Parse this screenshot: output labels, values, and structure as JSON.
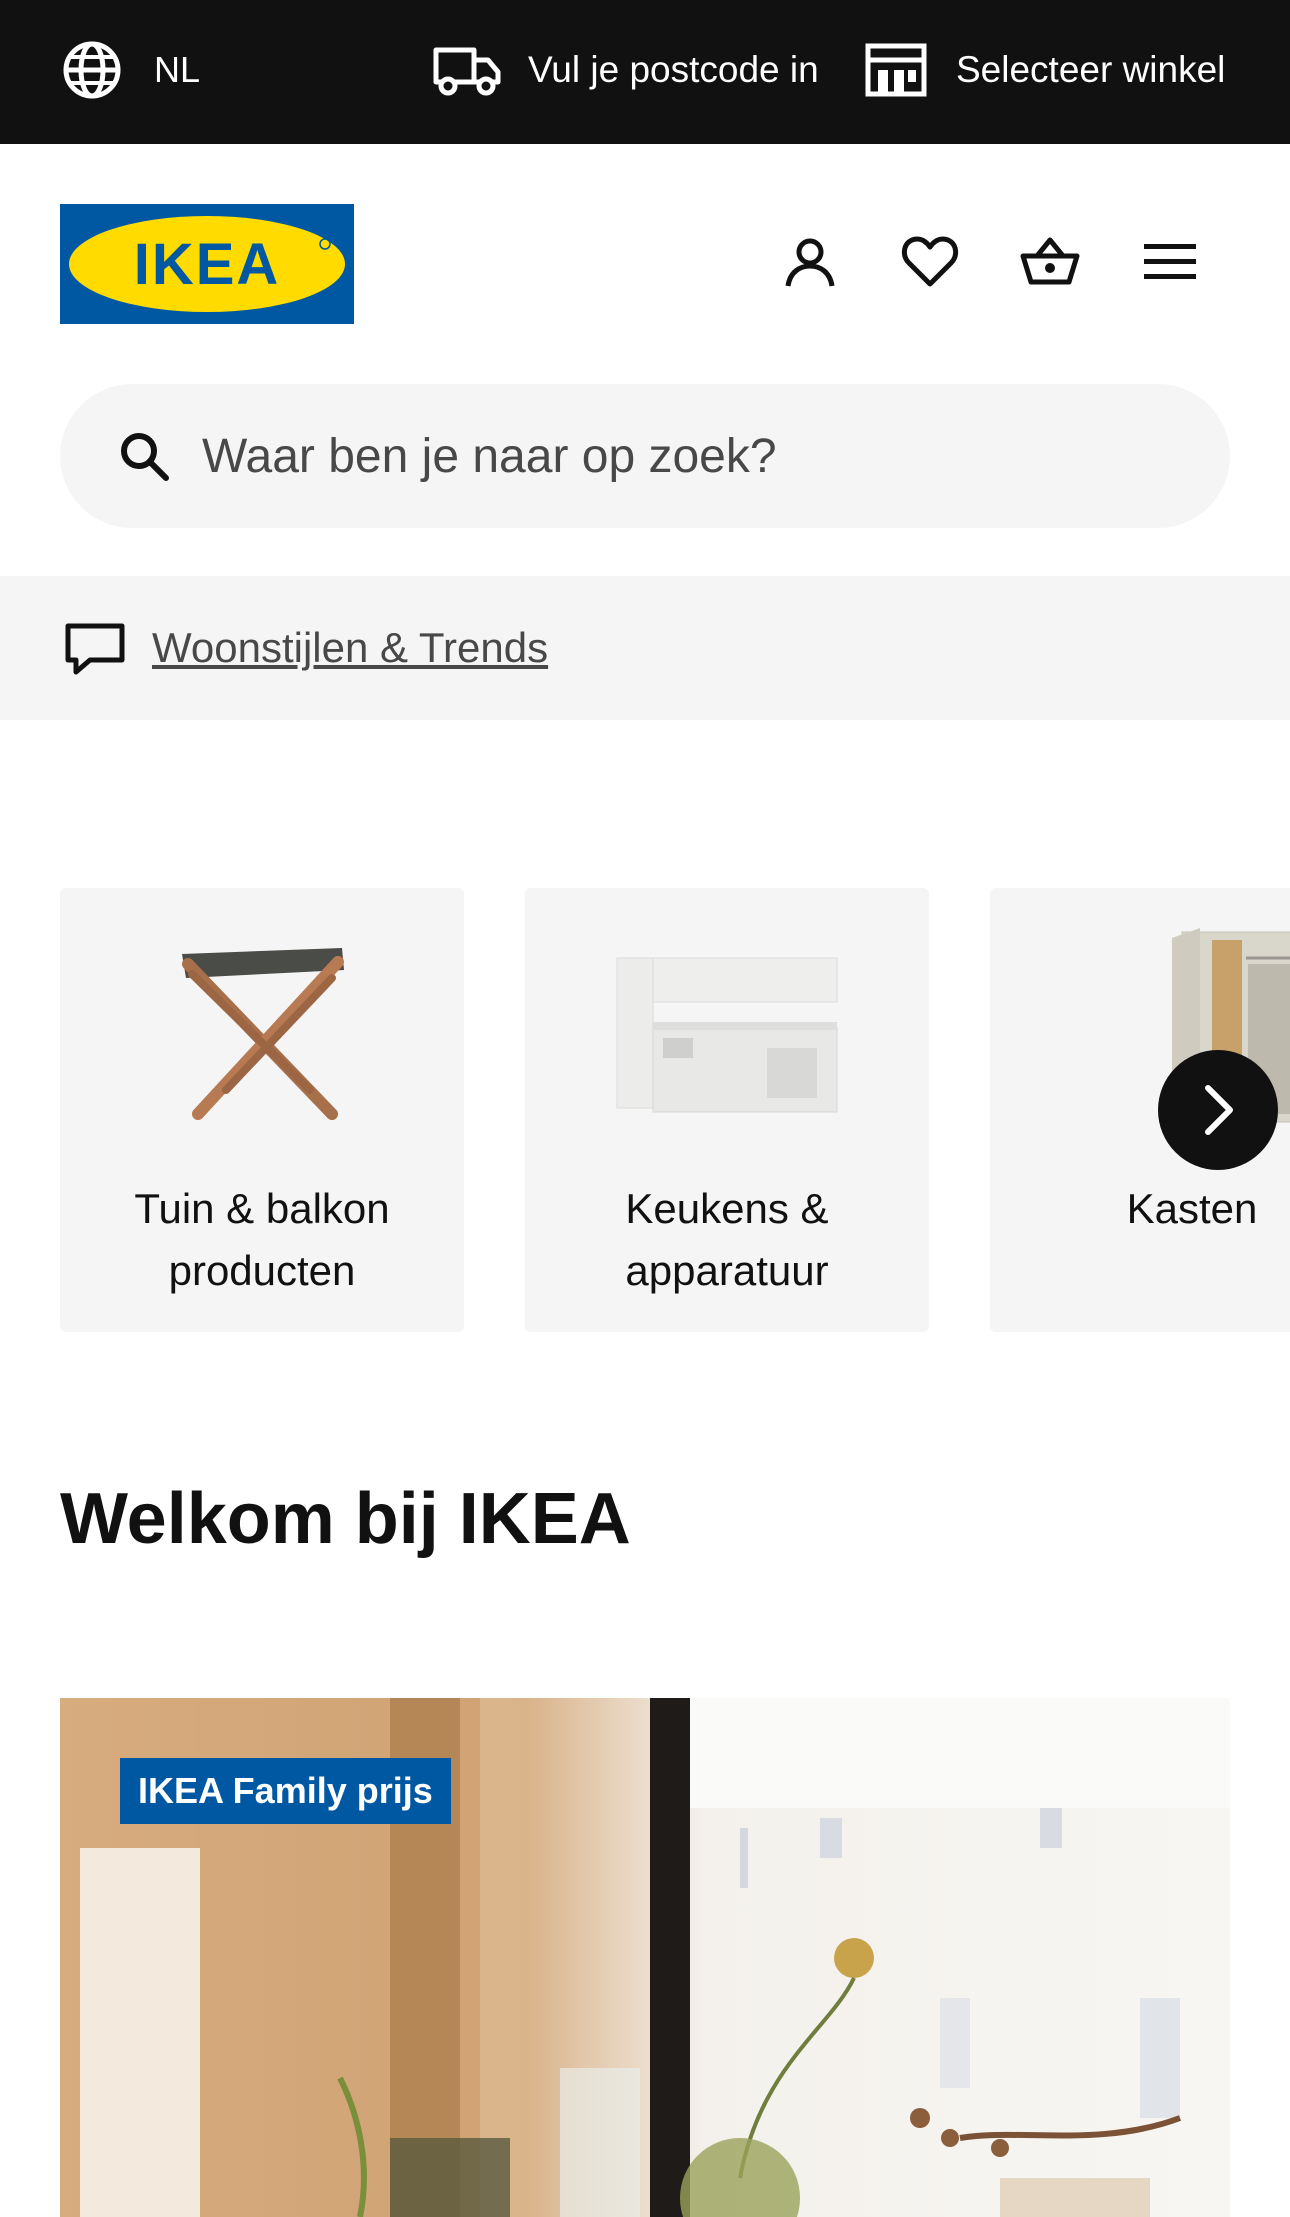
{
  "topbar": {
    "language": "NL",
    "postcode_label": "Vul je postcode in",
    "store_label": "Selecteer winkel"
  },
  "header": {
    "logo_text": "IKEA",
    "icons": [
      "user-icon",
      "heart-icon",
      "basket-icon",
      "menu-icon"
    ]
  },
  "search": {
    "placeholder": "Waar ben je naar op zoek?"
  },
  "trends": {
    "label": "Woonstijlen & Trends"
  },
  "categories": [
    {
      "label": "Tuin & balkon producten"
    },
    {
      "label": "Keukens & apparatuur"
    },
    {
      "label": "Kasten"
    }
  ],
  "welcome": {
    "title": "Welkom bij IKEA"
  },
  "hero": {
    "badge": "IKEA Family prijs"
  },
  "colors": {
    "topbar": "#111111",
    "ikea_blue": "#0058a3",
    "ikea_yellow": "#ffdb00",
    "surface": "#f5f5f5"
  }
}
